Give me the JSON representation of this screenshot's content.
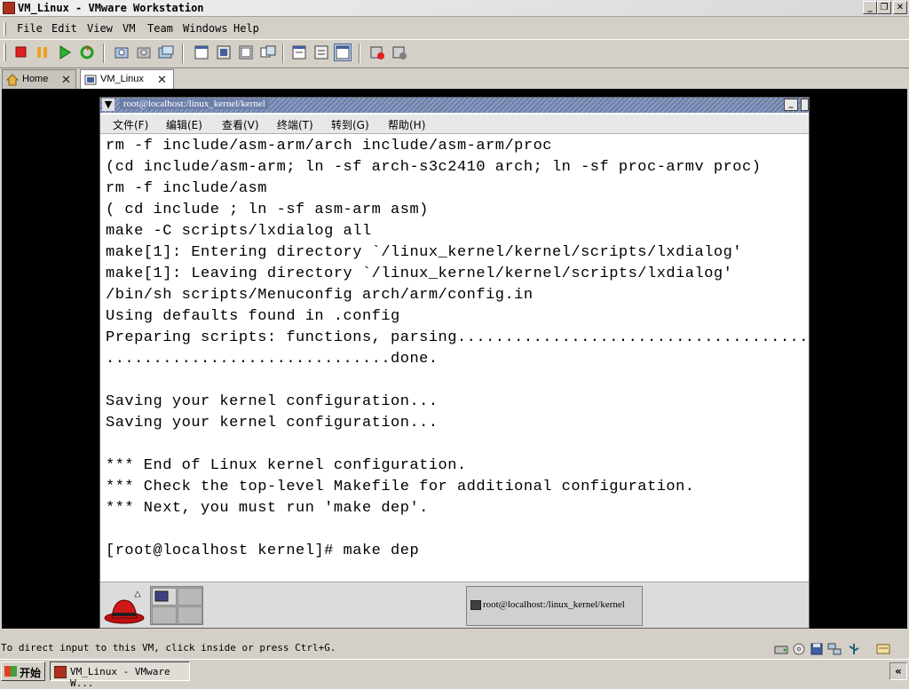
{
  "window": {
    "title": "VM_Linux - VMware Workstation",
    "buttons": {
      "minimize": "_",
      "restore": "❐",
      "close": "✕"
    }
  },
  "menubar": {
    "items": [
      "File",
      "Edit",
      "View",
      "VM",
      "Team",
      "Windows",
      "Help"
    ]
  },
  "toolbar": {
    "buttons": [
      "power-off-icon",
      "suspend-icon",
      "power-on-icon",
      "reset-icon",
      "snapshot-icon",
      "revert-icon",
      "snapshot-manager-icon",
      "quick-switch-icon",
      "full-screen-icon",
      "fit-window-icon",
      "summary-view-icon",
      "console-view-icon",
      "appliance-view-icon",
      "show-toolbar-icon",
      "preferences-icon",
      "help-icon"
    ]
  },
  "tabs": [
    {
      "label": "Home",
      "active": false
    },
    {
      "label": "VM_Linux",
      "active": true
    }
  ],
  "guest": {
    "window_title": "root@localhost:/linux_kernel/kernel",
    "menu": [
      "文件(F)",
      "编辑(E)",
      "查看(V)",
      "终端(T)",
      "转到(G)",
      "帮助(H)"
    ],
    "terminal_lines": [
      "rm -f include/asm-arm/arch include/asm-arm/proc",
      "(cd include/asm-arm; ln -sf arch-s3c2410 arch; ln -sf proc-armv proc)",
      "rm -f include/asm",
      "( cd include ; ln -sf asm-arm asm)",
      "make -C scripts/lxdialog all",
      "make[1]: Entering directory `/linux_kernel/kernel/scripts/lxdialog'",
      "make[1]: Leaving directory `/linux_kernel/kernel/scripts/lxdialog'",
      "/bin/sh scripts/Menuconfig arch/arm/config.in",
      "Using defaults found in .config",
      "Preparing scripts: functions, parsing.......................................",
      "..............................done.",
      "",
      "Saving your kernel configuration...",
      "Saving your kernel configuration...",
      "",
      "*** End of Linux kernel configuration.",
      "*** Check the top-level Makefile for additional configuration.",
      "*** Next, you must run 'make dep'.",
      "",
      "[root@localhost kernel]# make dep"
    ],
    "panel": {
      "task_label": "root@localhost:/linux_kernel/kernel"
    }
  },
  "statusbar": {
    "text": "To direct input to this VM, click inside or press Ctrl+G.",
    "icons": [
      "hard-disk-icon",
      "cdrom-icon",
      "floppy-icon",
      "network-icon",
      "usb-icon",
      "message-log-icon"
    ]
  },
  "taskbar": {
    "start_label": "开始",
    "task_label": "VM_Linux - VMware W...",
    "tray_label": "«"
  },
  "colors": {
    "vm_background": "#000000",
    "guest_titlebar": "#6d7fa8",
    "chrome": "#d4d0c8"
  }
}
